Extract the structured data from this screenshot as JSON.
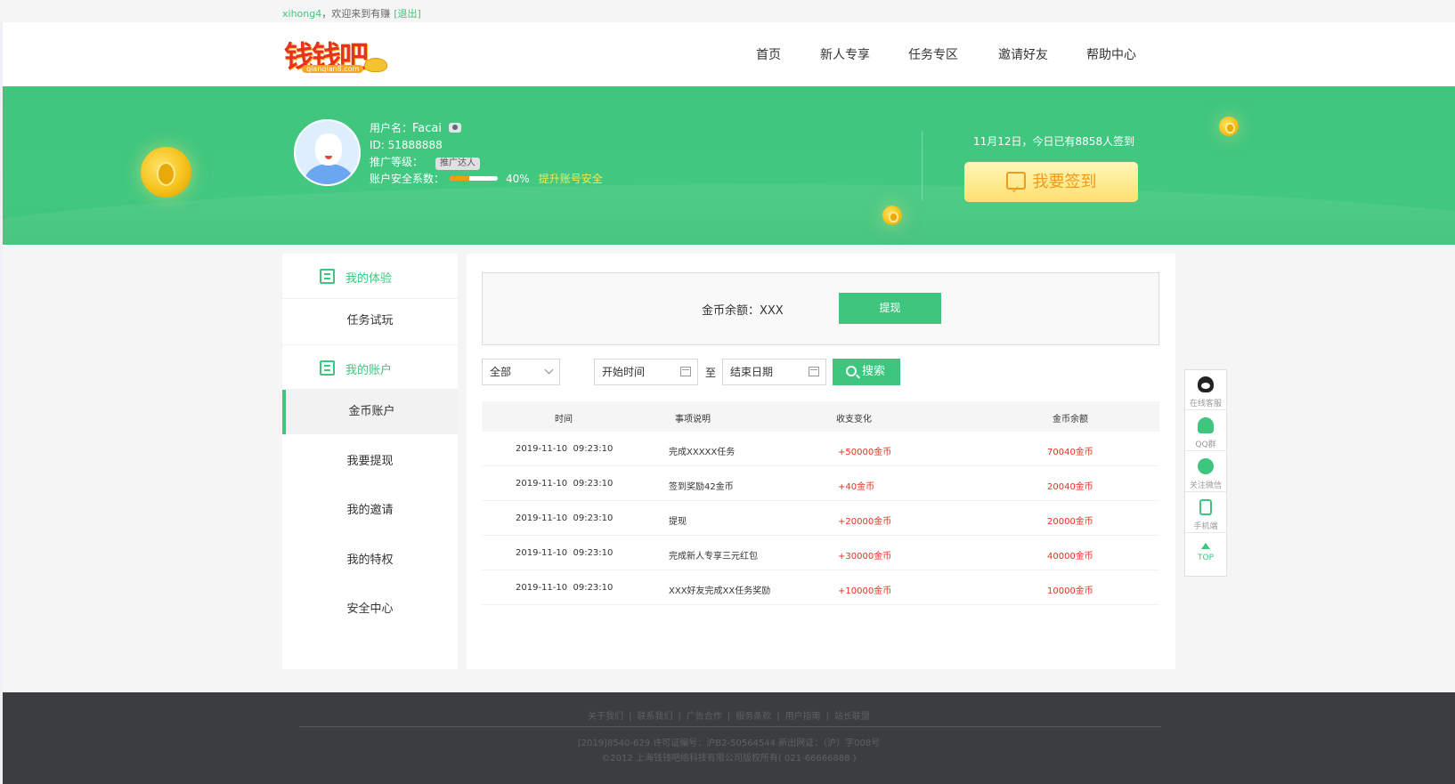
{
  "topbar": {
    "username": "xihong4",
    "welcome": "，欢迎来到有赚",
    "logout": "[退出]"
  },
  "logo": {
    "text": "钱钱吧",
    "sub": "qianqian8.com"
  },
  "nav": [
    "首页",
    "新人专享",
    "任务专区",
    "邀请好友",
    "帮助中心"
  ],
  "user": {
    "name_label": "用户名：",
    "name": "Facai",
    "id": "ID: 51888888",
    "level_label": "推广等级：",
    "level_badge": "推广达人",
    "security_label": "账户安全系数：",
    "security_percent": 40,
    "security_text": "40%",
    "security_link": "提升账号安全"
  },
  "signin": {
    "info": "11月12日，今日已有8858人签到",
    "button": "我要签到"
  },
  "sidebar": {
    "sections": [
      {
        "label": "我的体验",
        "items": [
          "任务试玩"
        ]
      },
      {
        "label": "我的账户",
        "items": [
          "金币账户",
          "我要提现",
          "我的邀请",
          "我的特权",
          "安全中心"
        ]
      }
    ],
    "active": "金币账户"
  },
  "balance": {
    "label": "金币余额：XXX",
    "withdraw": "提现"
  },
  "filter": {
    "type": "全部",
    "start": "开始时间",
    "to": "至",
    "end": "结束日期",
    "search": "搜索"
  },
  "table": {
    "headers": [
      "时间",
      "事项说明",
      "收支变化",
      "金币余额"
    ],
    "rows": [
      [
        "2019-11-10  09:23:10",
        "完成XXXXX任务",
        "+50000金币",
        "70040金币"
      ],
      [
        "2019-11-10  09:23:10",
        "签到奖励42金币",
        "+40金币",
        "20040金币"
      ],
      [
        "2019-11-10  09:23:10",
        "提现",
        "+20000金币",
        "20000金币"
      ],
      [
        "2019-11-10  09:23:10",
        "完成新人专享三元红包",
        "+30000金币",
        "40000金币"
      ],
      [
        "2019-11-10  09:23:10",
        "XXX好友完成XX任务奖励",
        "+10000金币",
        "10000金币"
      ]
    ]
  },
  "tools": [
    {
      "label": "在线客服",
      "icon": "qq-penguin-icon"
    },
    {
      "label": "QQ群",
      "icon": "group-icon"
    },
    {
      "label": "关注微信",
      "icon": "wechat-icon"
    },
    {
      "label": "手机端",
      "icon": "mobile-icon"
    },
    {
      "label": "TOP",
      "icon": "arrow-up-icon"
    }
  ],
  "footer": {
    "links": [
      "关于我们",
      "联系我们",
      "广告合作",
      "服务条款",
      "用户指南",
      "站长联盟"
    ],
    "line1": "[2019]8540-629 许可证编号：沪B2-50564544  新出网证：（沪）字008号",
    "line2": "©2012 上海钱钱吧络科技有限公司版权所有( 021-66666888 )"
  },
  "colors": {
    "accent": "#3ec57e",
    "red": "#e8311f",
    "gold": "#f5c21a"
  }
}
